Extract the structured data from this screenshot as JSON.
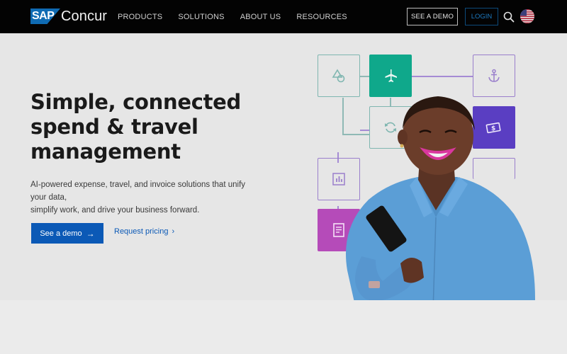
{
  "header": {
    "logo": {
      "sap": "SAP",
      "product": "Concur"
    },
    "nav": [
      "PRODUCTS",
      "SOLUTIONS",
      "ABOUT US",
      "RESOURCES"
    ],
    "see_demo_label": "SEE A DEMO",
    "login_label": "LOGIN",
    "search_icon": "search-icon",
    "locale_icon": "us-flag-icon"
  },
  "hero": {
    "headline_1": "Simple, connected",
    "headline_2": "spend & travel",
    "headline_3": "management",
    "subtext_1": "AI-powered expense, travel, and invoice solutions that unify your data,",
    "subtext_2": "simplify work, and drive your business forward.",
    "primary_cta": "See a demo",
    "secondary_cta": "Request pricing"
  },
  "illustration": {
    "tiles": [
      "shapes-icon",
      "airplane-icon",
      "anchor-icon",
      "sync-icon",
      "money-icon",
      "chart-icon",
      "receipt-icon"
    ]
  },
  "colors": {
    "topbar": "#030303",
    "brand_blue": "#0b59b6",
    "teal": "#0fa88b",
    "violet": "#5a3ec2",
    "magenta": "#b54bb9"
  }
}
